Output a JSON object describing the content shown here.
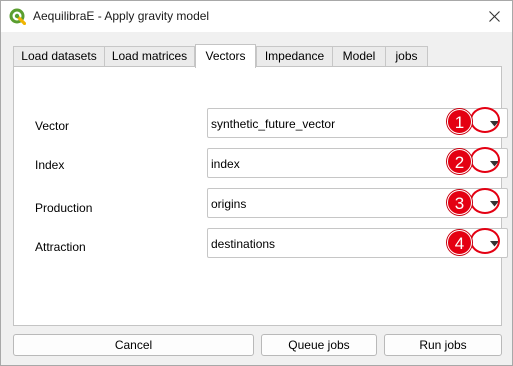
{
  "window": {
    "title": "AequilibraE - Apply gravity model",
    "close_icon": "close-icon",
    "app_icon": "qgis-logo-icon"
  },
  "tabs": [
    {
      "label": "Load datasets",
      "active": false
    },
    {
      "label": "Load matrices",
      "active": false
    },
    {
      "label": "Vectors",
      "active": true
    },
    {
      "label": "Impedance",
      "active": false
    },
    {
      "label": "Model",
      "active": false
    },
    {
      "label": "jobs",
      "active": false
    }
  ],
  "fields": [
    {
      "label": "Vector",
      "value": "synthetic_future_vector",
      "marker": "1"
    },
    {
      "label": "Index",
      "value": "index",
      "marker": "2"
    },
    {
      "label": "Production",
      "value": "origins",
      "marker": "3"
    },
    {
      "label": "Attraction",
      "value": "destinations",
      "marker": "4"
    }
  ],
  "buttons": {
    "cancel": "Cancel",
    "queue": "Queue jobs",
    "run": "Run jobs"
  },
  "colors": {
    "marker_red": "#e40012",
    "active_tab": "#ffffff",
    "dialog_bg": "#f0f0f0"
  }
}
